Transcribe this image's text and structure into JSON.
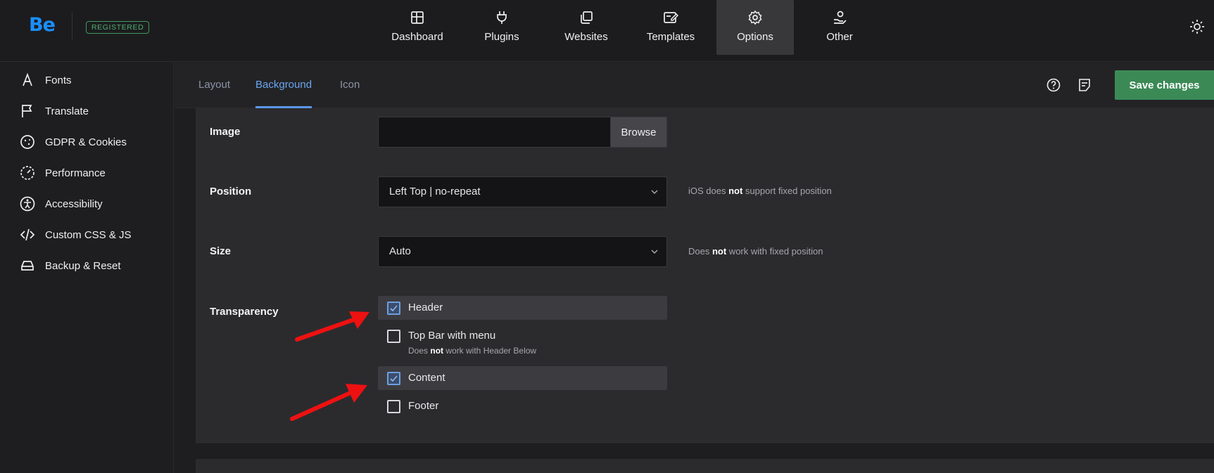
{
  "brand": {
    "logo": "Be",
    "badge": "REGISTERED",
    "accent": "#1a8fff"
  },
  "topnav": [
    {
      "label": "Dashboard",
      "icon": "dashboard-icon"
    },
    {
      "label": "Plugins",
      "icon": "plug-icon"
    },
    {
      "label": "Websites",
      "icon": "websites-icon"
    },
    {
      "label": "Templates",
      "icon": "templates-icon"
    },
    {
      "label": "Options",
      "icon": "gear-icon",
      "active": true
    },
    {
      "label": "Other",
      "icon": "user-hand-icon"
    }
  ],
  "sidebar": {
    "items": [
      {
        "label": "Fonts",
        "icon": "font-a-icon"
      },
      {
        "label": "Translate",
        "icon": "flag-icon"
      },
      {
        "label": "GDPR & Cookies",
        "icon": "cookie-icon"
      },
      {
        "label": "Performance",
        "icon": "gauge-icon"
      },
      {
        "label": "Accessibility",
        "icon": "accessibility-icon"
      },
      {
        "label": "Custom CSS & JS",
        "icon": "code-icon"
      },
      {
        "label": "Backup & Reset",
        "icon": "drive-icon"
      }
    ]
  },
  "tabs": [
    {
      "label": "Layout"
    },
    {
      "label": "Background",
      "active": true
    },
    {
      "label": "Icon"
    }
  ],
  "header_actions": {
    "save_label": "Save changes",
    "save_color": "#3b8a56"
  },
  "form": {
    "image": {
      "label": "Image",
      "value": "",
      "browse_label": "Browse"
    },
    "position": {
      "label": "Position",
      "value": "Left Top | no-repeat",
      "hint_pre": "iOS does ",
      "hint_bold": "not",
      "hint_post": " support fixed position"
    },
    "size": {
      "label": "Size",
      "value": "Auto",
      "hint_pre": "Does ",
      "hint_bold": "not",
      "hint_post": " work with fixed position"
    },
    "transparency": {
      "label": "Transparency",
      "options": [
        {
          "label": "Header",
          "checked": true
        },
        {
          "label": "Top Bar with menu",
          "checked": false
        },
        {
          "label": "Content",
          "checked": true
        },
        {
          "label": "Footer",
          "checked": false
        }
      ],
      "topbar_note_pre": "Does ",
      "topbar_note_bold": "not",
      "topbar_note_post": " work with Header Below"
    }
  }
}
